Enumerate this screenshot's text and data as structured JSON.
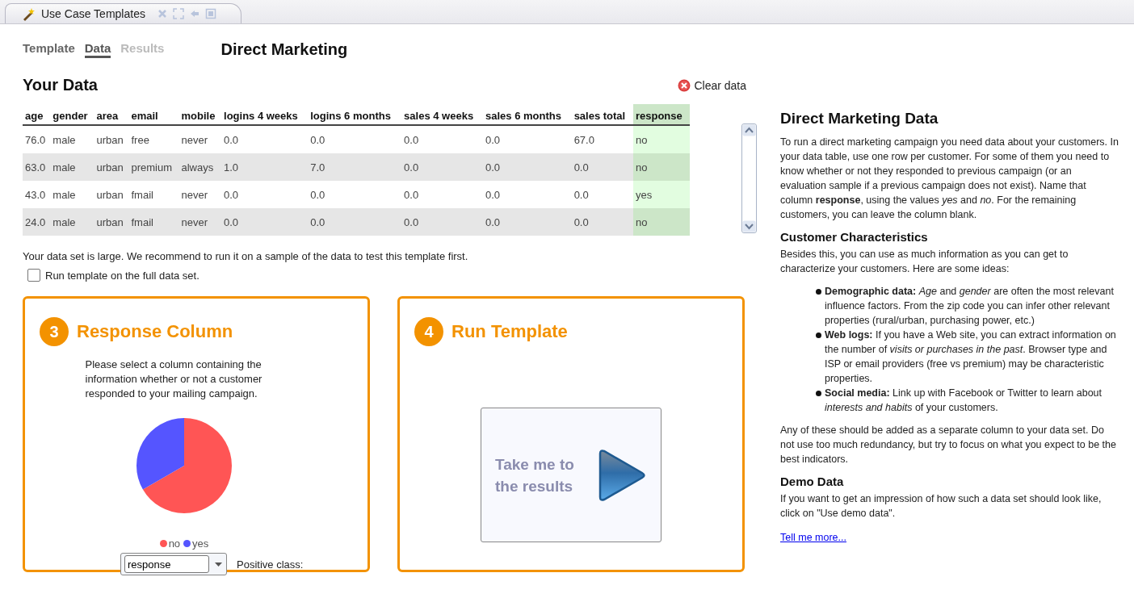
{
  "editor_tab": {
    "title": "Use Case Templates"
  },
  "nav_tabs": [
    {
      "label": "Template",
      "selected": false,
      "disabled": false
    },
    {
      "label": "Data",
      "selected": true,
      "disabled": false
    },
    {
      "label": "Results",
      "selected": false,
      "disabled": true
    }
  ],
  "page_title": "Direct Marketing",
  "data_section": {
    "title": "Your Data",
    "clear_button": "Clear data"
  },
  "table": {
    "columns": [
      {
        "label": "age",
        "highlighted": false
      },
      {
        "label": "gender",
        "highlighted": false
      },
      {
        "label": "area",
        "highlighted": false
      },
      {
        "label": "email",
        "highlighted": false
      },
      {
        "label": "mobile",
        "highlighted": false
      },
      {
        "label": "logins 4 weeks",
        "highlighted": false
      },
      {
        "label": "logins 6 months",
        "highlighted": false
      },
      {
        "label": "sales 4 weeks",
        "highlighted": false
      },
      {
        "label": "sales 6 months",
        "highlighted": false
      },
      {
        "label": "sales total",
        "highlighted": false
      },
      {
        "label": "response",
        "highlighted": true
      }
    ],
    "rows": [
      [
        "76.0",
        "male",
        "urban",
        "free",
        "never",
        "0.0",
        "0.0",
        "0.0",
        "0.0",
        "67.0",
        "no"
      ],
      [
        "63.0",
        "male",
        "urban",
        "premium",
        "always",
        "1.0",
        "7.0",
        "0.0",
        "0.0",
        "0.0",
        "no"
      ],
      [
        "43.0",
        "male",
        "urban",
        "fmail",
        "never",
        "0.0",
        "0.0",
        "0.0",
        "0.0",
        "0.0",
        "yes"
      ],
      [
        "24.0",
        "male",
        "urban",
        "fmail",
        "never",
        "0.0",
        "0.0",
        "0.0",
        "0.0",
        "0.0",
        "no"
      ]
    ]
  },
  "sample_note": "Your data set is large. We recommend to run it on a sample of the data to test this template first.",
  "full_data_checkbox": {
    "label": "Run template on the full data set.",
    "checked": false
  },
  "response_card": {
    "step": "3",
    "title": "Response Column",
    "description": "Please select a column containing the information whether or not a customer responded to your mailing campaign.",
    "legend": [
      {
        "label": "no",
        "color": "#ff5555"
      },
      {
        "label": "yes",
        "color": "#5555ff"
      }
    ],
    "column_select": {
      "value": "response"
    },
    "positive_class_label": "Positive class:"
  },
  "run_card": {
    "step": "4",
    "title": "Run Template",
    "results_button": "Take me to the results"
  },
  "help": {
    "title": "Direct Marketing Data",
    "sections": [
      {
        "kind": "paragraph",
        "text": "To run a direct marketing campaign you need data about your customers. In your data table, use one row per customer. For some of them you need to know whether or not they responded to previous campaign (or an evaluation sample if a previous campaign does not exist). Name that column **response**, using the values *yes* and *no*. For the remaining customers, you can leave the column blank."
      },
      {
        "kind": "heading",
        "text": "Customer Characteristics"
      },
      {
        "kind": "paragraph",
        "text": "Besides this, you can use as much information as you can get to characterize your customers. Here are some ideas:"
      },
      {
        "kind": "bullets",
        "items": [
          "**Demographic data:** *Age* and *gender* are often the most relevant influence factors. From the zip code you can infer other relevant properties (rural/urban, purchasing power, etc.)",
          "**Web logs:** If you have a Web site, you can extract information on the number of *visits or purchases in the past*. Browser type and ISP or email providers (free vs premium) may be characteristic properties.",
          "**Social media:** Link up with Facebook or Twitter to learn about *interests and habits* of your customers."
        ]
      },
      {
        "kind": "paragraph",
        "text": "Any of these should be added as a separate column to your data set. Do not use too much redundancy, but try to focus on what you expect to be the best indicators."
      },
      {
        "kind": "heading",
        "text": "Demo Data"
      },
      {
        "kind": "paragraph",
        "text": "If you want to get an impression of how such a data set should look like, click on \"Use demo data\"."
      },
      {
        "kind": "link",
        "text": "Tell me more..."
      }
    ]
  }
}
